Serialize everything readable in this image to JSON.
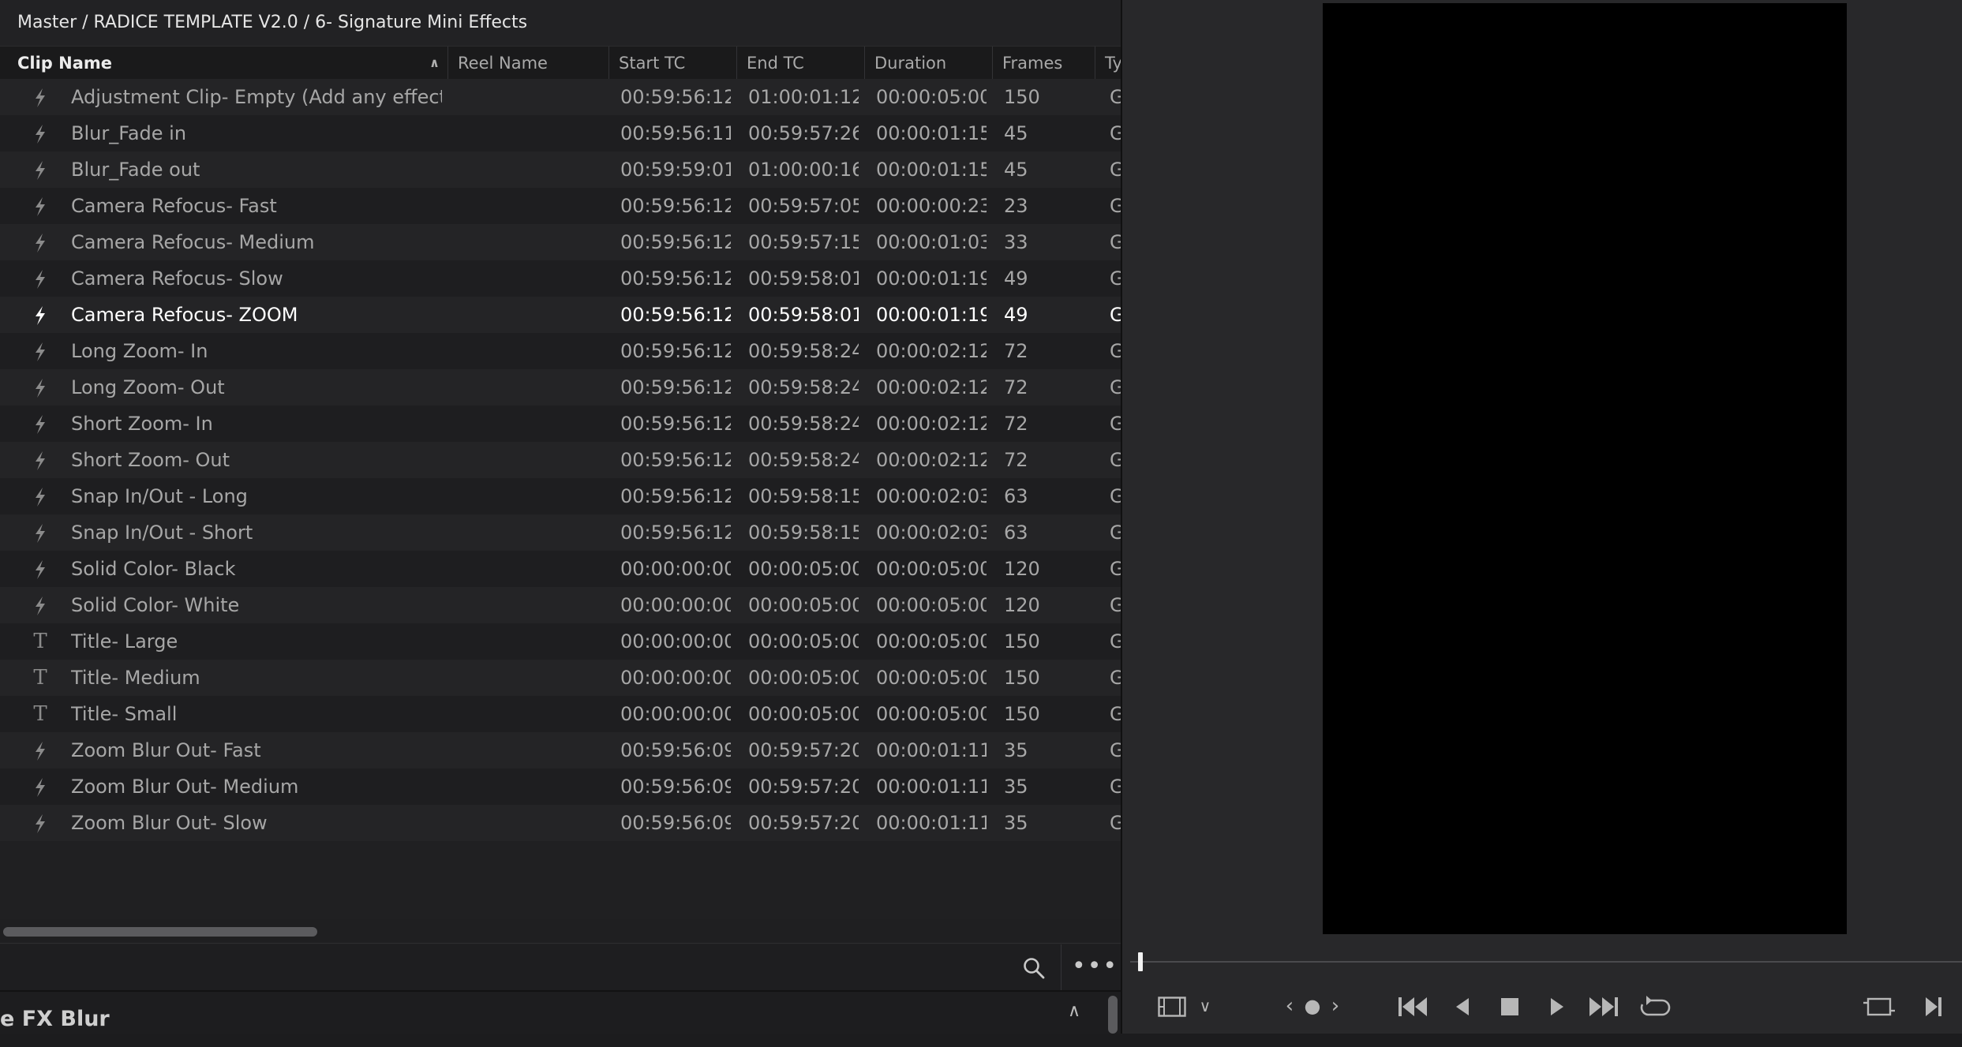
{
  "breadcrumb": "Master / RADICE TEMPLATE V2.0 / 6- Signature Mini Effects",
  "columns": {
    "clip_name": "Clip Name",
    "reel_name": "Reel Name",
    "start_tc": "Start TC",
    "end_tc": "End TC",
    "duration": "Duration",
    "frames": "Frames",
    "type": "Ty"
  },
  "rows": [
    {
      "icon": "lightning-icon",
      "name": "Adjustment Clip- Empty (Add any effect)",
      "start": "00:59:56:12",
      "end": "01:00:01:12",
      "duration": "00:00:05:00",
      "frames": "150",
      "type": "G"
    },
    {
      "icon": "lightning-icon",
      "name": "Blur_Fade in",
      "start": "00:59:56:11",
      "end": "00:59:57:26",
      "duration": "00:00:01:15",
      "frames": "45",
      "type": "G"
    },
    {
      "icon": "lightning-icon",
      "name": "Blur_Fade out",
      "start": "00:59:59:01",
      "end": "01:00:00:16",
      "duration": "00:00:01:15",
      "frames": "45",
      "type": "G"
    },
    {
      "icon": "lightning-icon",
      "name": "Camera Refocus- Fast",
      "start": "00:59:56:12",
      "end": "00:59:57:05",
      "duration": "00:00:00:23",
      "frames": "23",
      "type": "G"
    },
    {
      "icon": "lightning-icon",
      "name": "Camera Refocus- Medium",
      "start": "00:59:56:12",
      "end": "00:59:57:15",
      "duration": "00:00:01:03",
      "frames": "33",
      "type": "G"
    },
    {
      "icon": "lightning-icon",
      "name": "Camera Refocus- Slow",
      "start": "00:59:56:12",
      "end": "00:59:58:01",
      "duration": "00:00:01:19",
      "frames": "49",
      "type": "G"
    },
    {
      "icon": "lightning-icon",
      "name": "Camera Refocus- ZOOM",
      "start": "00:59:56:12",
      "end": "00:59:58:01",
      "duration": "00:00:01:19",
      "frames": "49",
      "type": "G",
      "selected": true
    },
    {
      "icon": "lightning-icon",
      "name": "Long Zoom- In",
      "start": "00:59:56:12",
      "end": "00:59:58:24",
      "duration": "00:00:02:12",
      "frames": "72",
      "type": "G"
    },
    {
      "icon": "lightning-icon",
      "name": "Long Zoom- Out",
      "start": "00:59:56:12",
      "end": "00:59:58:24",
      "duration": "00:00:02:12",
      "frames": "72",
      "type": "G"
    },
    {
      "icon": "lightning-icon",
      "name": "Short Zoom- In",
      "start": "00:59:56:12",
      "end": "00:59:58:24",
      "duration": "00:00:02:12",
      "frames": "72",
      "type": "G"
    },
    {
      "icon": "lightning-icon",
      "name": "Short Zoom- Out",
      "start": "00:59:56:12",
      "end": "00:59:58:24",
      "duration": "00:00:02:12",
      "frames": "72",
      "type": "G"
    },
    {
      "icon": "lightning-icon",
      "name": "Snap In/Out - Long",
      "start": "00:59:56:12",
      "end": "00:59:58:15",
      "duration": "00:00:02:03",
      "frames": "63",
      "type": "G"
    },
    {
      "icon": "lightning-icon",
      "name": "Snap In/Out - Short",
      "start": "00:59:56:12",
      "end": "00:59:58:15",
      "duration": "00:00:02:03",
      "frames": "63",
      "type": "G"
    },
    {
      "icon": "lightning-icon",
      "name": "Solid Color- Black",
      "start": "00:00:00:00",
      "end": "00:00:05:00",
      "duration": "00:00:05:00",
      "frames": "120",
      "type": "G"
    },
    {
      "icon": "lightning-icon",
      "name": "Solid Color- White",
      "start": "00:00:00:00",
      "end": "00:00:05:00",
      "duration": "00:00:05:00",
      "frames": "120",
      "type": "G"
    },
    {
      "icon": "title-t-icon",
      "name": "Title- Large",
      "start": "00:00:00:00",
      "end": "00:00:05:00",
      "duration": "00:00:05:00",
      "frames": "150",
      "type": "G"
    },
    {
      "icon": "title-t-icon",
      "name": "Title- Medium",
      "start": "00:00:00:00",
      "end": "00:00:05:00",
      "duration": "00:00:05:00",
      "frames": "150",
      "type": "G"
    },
    {
      "icon": "title-t-icon",
      "name": "Title- Small",
      "start": "00:00:00:00",
      "end": "00:00:05:00",
      "duration": "00:00:05:00",
      "frames": "150",
      "type": "G"
    },
    {
      "icon": "lightning-icon",
      "name": "Zoom Blur Out- Fast",
      "start": "00:59:56:09",
      "end": "00:59:57:20",
      "duration": "00:00:01:11",
      "frames": "35",
      "type": "G"
    },
    {
      "icon": "lightning-icon",
      "name": "Zoom Blur Out- Medium",
      "start": "00:59:56:09",
      "end": "00:59:57:20",
      "duration": "00:00:01:11",
      "frames": "35",
      "type": "G"
    },
    {
      "icon": "lightning-icon",
      "name": "Zoom Blur Out- Slow",
      "start": "00:59:56:09",
      "end": "00:59:57:20",
      "duration": "00:00:01:11",
      "frames": "35",
      "type": "G"
    }
  ],
  "panel": {
    "title": "e FX Blur"
  },
  "viewer": {
    "playhead_fraction": 0.0
  },
  "colors": {
    "background": "#1c1c1e",
    "row_odd": "#242426",
    "row_even": "#1e1e20",
    "text": "#a7a7a7",
    "selected_text": "#ffffff"
  }
}
